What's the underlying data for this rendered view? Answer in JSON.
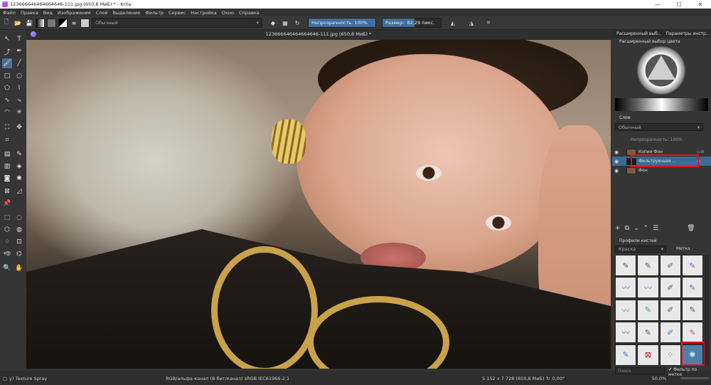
{
  "window": {
    "title": "123666646464664646-111.jpg (650,8 МиБ) * - Krita",
    "min": "—",
    "max": "☐",
    "close": "✕"
  },
  "menu": [
    "Файл",
    "Правка",
    "Вид",
    "Изображение",
    "Слой",
    "Выделение",
    "Фильтр",
    "Сервис",
    "Настройка",
    "Окно",
    "Справка"
  ],
  "toolbar": {
    "blend_mode": "Обычный",
    "opacity_label": "Непрозрачность: 100%",
    "opacity_value": 1.0,
    "size_label": "Размер:",
    "size_value": "82,29 пикс.",
    "size_fill": 0.55
  },
  "document": {
    "tab_title": "123666646464664646-111.jpg (650,8 МиБ) *"
  },
  "panels": {
    "tab1": "Расширенный выб...",
    "tab2": "Параметры инстр...",
    "color_header": "Расширенный выбор цвета",
    "layers_header": "Слои",
    "layer_blend": "Обычный",
    "layer_opacity": "Непрозрачность:  100%",
    "layers": [
      {
        "name": "Копия Фон",
        "color": "#7a5a48"
      },
      {
        "name": "Фильтрующая ...",
        "color": "#1b1b1b"
      },
      {
        "name": "Фон",
        "color": "#7a5a48"
      }
    ],
    "brushes_header": "Профили кистей",
    "brush_category": "Краска",
    "brush_tag_label": "Метка",
    "search_placeholder": "Поиск",
    "filter_by_tag": "Фильтр по метке"
  },
  "status": {
    "brush_name": "y) Texture Spray",
    "color_space": "RGB/альфа-канал (8-бит/канал)  sRGB IEC61966-2.1",
    "dimensions": "5 152 x 7 728 (650,8 МиБ)",
    "rotation": "0,00°",
    "zoom": "50,0%"
  },
  "colors": {
    "accent": "#3f6fa0",
    "highlight": "#e0141e"
  }
}
